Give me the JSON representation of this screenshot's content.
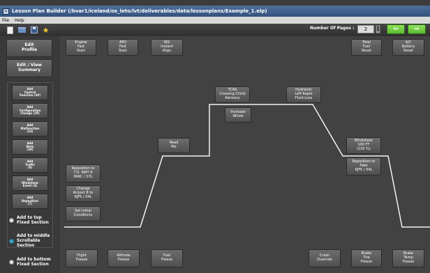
{
  "window": {
    "title": "Lesson Plan Builder (/bvar1/iceland/os_leto/lvt/deliverables/data/lessonplans/Example_1.elp)"
  },
  "menu": {
    "items": [
      "File",
      "Help"
    ]
  },
  "toolbar": {
    "icons": [
      "new-file-icon",
      "open-folder-icon",
      "save-icon",
      "favorite-star-icon"
    ],
    "pages_label": "Number Of Pages :",
    "pages_value": "2",
    "prev_glyph": "⇦",
    "next_glyph": "⇨",
    "nav_color": "#5cba32"
  },
  "sidebar": {
    "edit_profile": "Edit\nProfile",
    "edit_summary": "Edit / View\nSummary",
    "add_buttons": [
      "Add\nControl\nFunction (20)",
      "Add\nConfiguration\nChange (28)",
      "Add\nMalfunction\n(14)",
      "Add\nNote\n(29)",
      "Add\nTraffic\n(9)",
      "Add\nWindshear\nEvent (4)",
      "Add\nReposition\n(7)"
    ],
    "sections": [
      {
        "label": "Add to top\nFixed Section",
        "checked": false
      },
      {
        "label": "Add to middle\nScrollable\nSection",
        "checked": true
      },
      {
        "label": "Add to bottom\nFixed Section",
        "checked": false
      }
    ]
  },
  "canvas": {
    "top_blocks": [
      "Engine\nFast\nStart",
      "APU\nFast\nStart",
      "IRS\nInstant\nAlign",
      "Total\nFuel\nReset",
      "A/C\nBattery\nReset"
    ],
    "bottom_blocks": [
      "Flight\nFreeze",
      "Altitude\nFreeze",
      "Fuel\nFreeze",
      "Crash\nOverride",
      "Brake\nTire\nFreeze",
      "Brake\nTemp\nFreeze"
    ],
    "profile_blocks": [
      "Reposition to\nT.O. RWY 8\nPANC / 07L",
      "Change\nAirport 8 to\nKJFK / 04L",
      "Set Initial\nConditions",
      "Read\nMe",
      "TCAS\nCrossing Climb\nAdvisory",
      "Increase\nWinds",
      "Hydraulic\nLeft Rapid\nFluid Loss",
      "Windshear\n100 FT\n(100 %)",
      "Reposition to\nFake\nKJFK / 04L"
    ],
    "line_color": "#f2f2f2"
  }
}
